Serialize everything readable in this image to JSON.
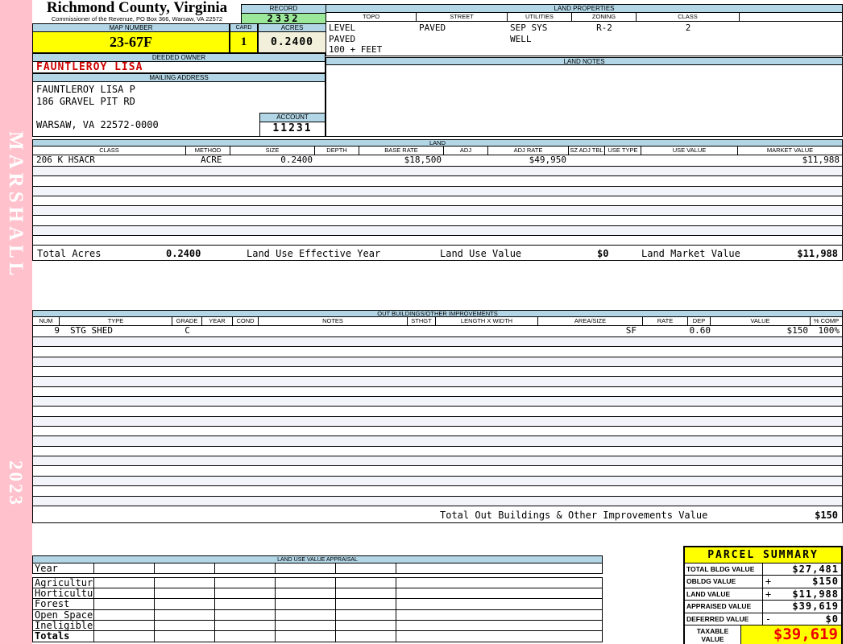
{
  "header": {
    "county": "Richmond County, Virginia",
    "subtitle": "Commissioner of the Revenue, PO Box 366, Warsaw, VA 22572",
    "record_label": "RECORD",
    "record_value": "2332",
    "map_number_label": "MAP NUMBER",
    "map_number_value": "23-67F",
    "card_label": "CARD",
    "card_value": "1",
    "acres_label": "ACRES",
    "acres_value": "0.2400"
  },
  "sidebar": {
    "vendor": "MARSHALL",
    "year": "2023"
  },
  "land_properties": {
    "title": "LAND PROPERTIES",
    "columns": [
      "TOPO",
      "STREET",
      "UTILITIES",
      "ZONING",
      "CLASS"
    ],
    "topo": "LEVEL\nPAVED\n100 + FEET",
    "street": "PAVED",
    "utilities": "SEP SYS\nWELL",
    "zoning": "R-2",
    "class": "2"
  },
  "owner": {
    "deeded_owner_label": "DEEDED OWNER",
    "deeded_owner": "FAUNTLEROY LISA",
    "mailing_address_label": "MAILING ADDRESS",
    "address_lines": [
      "FAUNTLEROY LISA P",
      "186 GRAVEL PIT RD",
      "",
      "WARSAW, VA 22572-0000"
    ],
    "account_label": "ACCOUNT",
    "account_value": "11231"
  },
  "land_notes": {
    "title": "LAND NOTES"
  },
  "land": {
    "title": "LAND",
    "columns": [
      "CLASS",
      "METHOD",
      "SIZE",
      "DEPTH",
      "BASE RATE",
      "ADJ",
      "ADJ RATE",
      "SZ ADJ TBL",
      "USE TYPE",
      "USE VALUE",
      "MARKET VALUE"
    ],
    "rows": [
      {
        "class": "206 K HSACR",
        "method": "ACRE",
        "size": "0.2400",
        "depth": "",
        "base_rate": "$18,500",
        "adj": "",
        "adj_rate": "$49,950",
        "sz_adj_tbl": "",
        "use_type": "",
        "use_value": "",
        "market_value": "$11,988"
      }
    ],
    "totals": {
      "total_acres_label": "Total Acres",
      "total_acres": "0.2400",
      "effective_year_label": "Land Use Effective Year",
      "land_use_value_label": "Land Use Value",
      "land_use_value": "$0",
      "land_market_value_label": "Land Market Value",
      "land_market_value": "$11,988"
    }
  },
  "out_buildings": {
    "title": "OUT BUILDINGS/OTHER IMPROVEMENTS",
    "columns": [
      "NUM",
      "TYPE",
      "GRADE",
      "YEAR",
      "COND",
      "NOTES",
      "STHGT",
      "LENGTH X WIDTH",
      "AREA/SIZE",
      "RATE",
      "DEP",
      "VALUE",
      "% COMP"
    ],
    "rows": [
      {
        "num": "9",
        "type": "STG SHED",
        "grade": "C",
        "year": "",
        "cond": "",
        "notes": "",
        "sthgt": "",
        "length_x_width": "",
        "area_size": "SF",
        "rate": "",
        "dep": "0.60",
        "value": "$150",
        "pct_comp": "100%"
      }
    ],
    "total_label": "Total Out Buildings & Other Improvements Value",
    "total_value": "$150"
  },
  "land_use_appraisal": {
    "title": "LAND USE VALUE APPRAISAL",
    "row_labels": [
      "Year",
      "Agriculture",
      "Horticulture",
      "Forest",
      "Open Space",
      "Ineligible",
      "Totals"
    ]
  },
  "parcel_summary": {
    "title": "PARCEL SUMMARY",
    "rows": [
      {
        "label": "TOTAL BLDG VALUE",
        "op": "",
        "value": "$27,481"
      },
      {
        "label": "OBLDG VALUE",
        "op": "+",
        "value": "$150"
      },
      {
        "label": "LAND VALUE",
        "op": "+",
        "value": "$11,988"
      },
      {
        "label": "APPRAISED VALUE",
        "op": "",
        "value": "$39,619"
      },
      {
        "label": "DEFERRED VALUE",
        "op": "-",
        "value": "$0"
      }
    ],
    "taxable_label": "TAXABLE VALUE",
    "taxable_value": "$39,619"
  }
}
